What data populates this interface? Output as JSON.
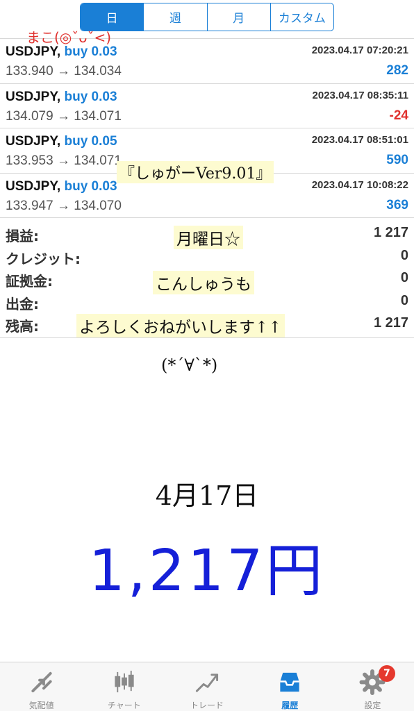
{
  "period_tabs": [
    {
      "label": "日",
      "active": true
    },
    {
      "label": "週",
      "active": false
    },
    {
      "label": "月",
      "active": false
    },
    {
      "label": "カスタム",
      "active": false
    }
  ],
  "deals": [
    {
      "symbol": "USDJPY,",
      "side": "buy 0.03",
      "time": "2023.04.17 07:20:21",
      "price_open": "133.940",
      "arrow": "→",
      "price_close": "134.034",
      "profit": "282"
    },
    {
      "symbol": "USDJPY,",
      "side": "buy 0.03",
      "time": "2023.04.17 08:35:11",
      "price_open": "134.079",
      "arrow": "→",
      "price_close": "134.071",
      "profit": "-24"
    },
    {
      "symbol": "USDJPY,",
      "side": "buy 0.05",
      "time": "2023.04.17 08:51:01",
      "price_open": "133.953",
      "arrow": "→",
      "price_close": "134.071",
      "profit": "590"
    },
    {
      "symbol": "USDJPY,",
      "side": "buy 0.03",
      "time": "2023.04.17 10:08:22",
      "price_open": "133.947",
      "arrow": "→",
      "price_close": "134.070",
      "profit": "369"
    }
  ],
  "summary": [
    {
      "label": "損益:",
      "value": "1 217"
    },
    {
      "label": "クレジット:",
      "value": "0"
    },
    {
      "label": "証拠金:",
      "value": "0"
    },
    {
      "label": "出金:",
      "value": "0"
    },
    {
      "label": "残高:",
      "value": "1 217"
    }
  ],
  "annotations": {
    "author": "まこ(◎ˇᴗˇ<)",
    "version": "『しゅがーVer9.01』",
    "monday": "月曜日☆",
    "this_week": "こんしゅうも",
    "regards": "よろしくおねがいします↑↑",
    "face": "(*´∀`*)",
    "date": "4月17日",
    "amount": "1,217円"
  },
  "tabbar": [
    {
      "label": "気配値",
      "icon": "quotes-icon",
      "active": false
    },
    {
      "label": "チャート",
      "icon": "chart-icon",
      "active": false
    },
    {
      "label": "トレード",
      "icon": "trade-icon",
      "active": false
    },
    {
      "label": "履歴",
      "icon": "history-icon",
      "active": true
    },
    {
      "label": "設定",
      "icon": "settings-icon",
      "active": false,
      "badge": "7"
    }
  ],
  "colors": {
    "accent": "#1a7fd6",
    "negative": "#e0312e",
    "amount_ink": "#1520d8"
  }
}
